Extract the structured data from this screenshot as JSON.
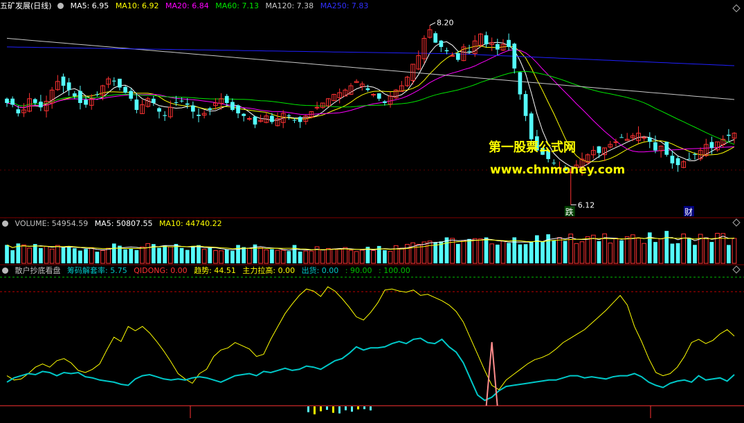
{
  "colors": {
    "up": "#ff3232",
    "down": "#54fcfc",
    "grid": "#800000",
    "white": "#ffffff",
    "yellow": "#ffff00",
    "magenta": "#ff00ff",
    "green": "#00e600",
    "gray": "#c8c8c8",
    "blue": "#2020ff",
    "pink": "#ff8c8c",
    "cyan_line": "#00c8c8",
    "dash_green": "#00c000",
    "dash_red": "#c00000"
  },
  "main": {
    "title": "五矿发展(日线)",
    "ma_labels": [
      {
        "text": "MA5: 6.95",
        "color": "#ffffff"
      },
      {
        "text": "MA10: 6.92",
        "color": "#ffff00"
      },
      {
        "text": "MA20: 6.84",
        "color": "#ff00ff"
      },
      {
        "text": "MA60: 7.13",
        "color": "#00e600"
      },
      {
        "text": "MA120: 7.38",
        "color": "#c8c8c8"
      },
      {
        "text": "MA250: 7.83",
        "color": "#2020ff"
      }
    ],
    "high_label": "8.20",
    "low_label": "6.12",
    "marker_die": "跌",
    "marker_cai": "财",
    "watermark_line1": "第一股票公式网",
    "watermark_line2": "www.chnmoney.com"
  },
  "volume": {
    "labels": [
      {
        "text": "VOLUME: 54954.59",
        "color": "#c0c0c0"
      },
      {
        "text": "MA5: 50807.55",
        "color": "#ffffff"
      },
      {
        "text": "MA10: 44740.22",
        "color": "#ffff00"
      }
    ]
  },
  "indicator": {
    "labels": [
      {
        "text": "散户抄底看盘",
        "color": "#c0c0c0"
      },
      {
        "text": "筹码解套率: 5.75",
        "color": "#00c8c8"
      },
      {
        "text": "QIDONG: 0.00",
        "color": "#ff3232"
      },
      {
        "text": "趋势: 44.51",
        "color": "#ffff00"
      },
      {
        "text": "主力拉高: 0.00",
        "color": "#ffff00"
      },
      {
        "text": "出货: 0.00",
        "color": "#00c8c8"
      },
      {
        "text": ": 90.00",
        "color": "#00c000"
      },
      {
        "text": ": 100.00",
        "color": "#00c000"
      }
    ]
  },
  "chart_data": [
    {
      "type": "candlestick",
      "title": "五矿发展(日线)",
      "ohlc_days": 130,
      "closes": [
        7.3,
        7.28,
        7.18,
        7.22,
        7.35,
        7.3,
        7.25,
        7.32,
        7.45,
        7.55,
        7.5,
        7.45,
        7.38,
        7.3,
        7.28,
        7.35,
        7.4,
        7.5,
        7.58,
        7.55,
        7.48,
        7.42,
        7.35,
        7.22,
        7.28,
        7.35,
        7.3,
        7.2,
        7.15,
        7.25,
        7.3,
        7.32,
        7.28,
        7.2,
        7.15,
        7.18,
        7.22,
        7.3,
        7.35,
        7.3,
        7.22,
        7.18,
        7.15,
        7.12,
        7.05,
        7.1,
        7.15,
        7.08,
        7.12,
        7.18,
        7.15,
        7.1,
        7.08,
        7.15,
        7.2,
        7.25,
        7.3,
        7.35,
        7.4,
        7.42,
        7.45,
        7.5,
        7.55,
        7.52,
        7.45,
        7.4,
        7.35,
        7.3,
        7.38,
        7.45,
        7.5,
        7.6,
        7.75,
        7.85,
        8.05,
        8.15,
        8.0,
        7.95,
        7.9,
        7.85,
        7.8,
        7.95,
        7.9,
        8.02,
        8.1,
        7.98,
        8.0,
        7.92,
        7.98,
        7.95,
        7.7,
        7.4,
        7.15,
        6.88,
        6.75,
        6.7,
        6.65,
        6.6,
        6.55,
        6.52,
        6.5,
        6.58,
        6.65,
        6.7,
        6.75,
        6.72,
        6.78,
        6.82,
        6.85,
        6.9,
        6.88,
        6.92,
        6.95,
        6.9,
        6.85,
        6.75,
        6.8,
        6.7,
        6.6,
        6.58,
        6.62,
        6.65,
        6.7,
        6.75,
        6.82,
        6.78,
        6.85,
        6.88,
        6.92,
        6.95
      ],
      "price_range": [
        6.05,
        8.35
      ],
      "ma5": 6.95,
      "ma10": 6.92,
      "ma20": 6.84,
      "ma60": 7.13,
      "ma120": 7.38,
      "ma250": 7.83,
      "annotations": [
        "8.20",
        "6.12"
      ]
    },
    {
      "type": "bar",
      "title": "VOLUME",
      "volume": 54954.59,
      "ma5": 50807.55,
      "ma10": 44740.22
    },
    {
      "type": "line",
      "title": "散户抄底看盘",
      "ylim": [
        0,
        120
      ],
      "series": [
        {
          "name": "趋势",
          "color": "#ffff00",
          "values": [
            28,
            24,
            25,
            30,
            36,
            39,
            36,
            42,
            44,
            40,
            33,
            31,
            34,
            39,
            52,
            64,
            60,
            74,
            70,
            74,
            68,
            60,
            51,
            41,
            30,
            25,
            21,
            30,
            34,
            46,
            52,
            54,
            59,
            56,
            53,
            46,
            48,
            62,
            74,
            86,
            95,
            103,
            109,
            107,
            102,
            111,
            107,
            100,
            92,
            83,
            80,
            87,
            96,
            108,
            109,
            107,
            106,
            108,
            103,
            104,
            101,
            98,
            94,
            88,
            78,
            63,
            48,
            33,
            19,
            15,
            24,
            29,
            34,
            39,
            43,
            45,
            48,
            53,
            59,
            63,
            67,
            71,
            77,
            83,
            89,
            96,
            103,
            94,
            74,
            60,
            44,
            31,
            28,
            30,
            36,
            46,
            59,
            62,
            58,
            61,
            67,
            71,
            65
          ]
        },
        {
          "name": "筹码解套率",
          "color": "#00c8c8",
          "values": [
            22,
            26,
            28,
            30,
            29,
            32,
            31,
            28,
            31,
            30,
            31,
            27,
            26,
            24,
            23,
            22,
            20,
            19,
            25,
            28,
            29,
            27,
            25,
            24,
            25,
            24,
            26,
            27,
            26,
            24,
            22,
            25,
            28,
            29,
            30,
            28,
            32,
            31,
            33,
            35,
            33,
            34,
            37,
            36,
            34,
            38,
            42,
            44,
            49,
            55,
            52,
            54,
            54,
            55,
            58,
            60,
            58,
            62,
            63,
            59,
            58,
            62,
            55,
            50,
            40,
            25,
            10,
            5,
            8,
            14,
            18,
            19,
            20,
            21,
            22,
            23,
            24,
            24,
            26,
            28,
            28,
            26,
            27,
            26,
            25,
            27,
            28,
            28,
            30,
            27,
            22,
            19,
            17,
            21,
            23,
            24,
            22,
            28,
            24,
            25,
            26,
            23,
            29
          ]
        }
      ]
    }
  ]
}
